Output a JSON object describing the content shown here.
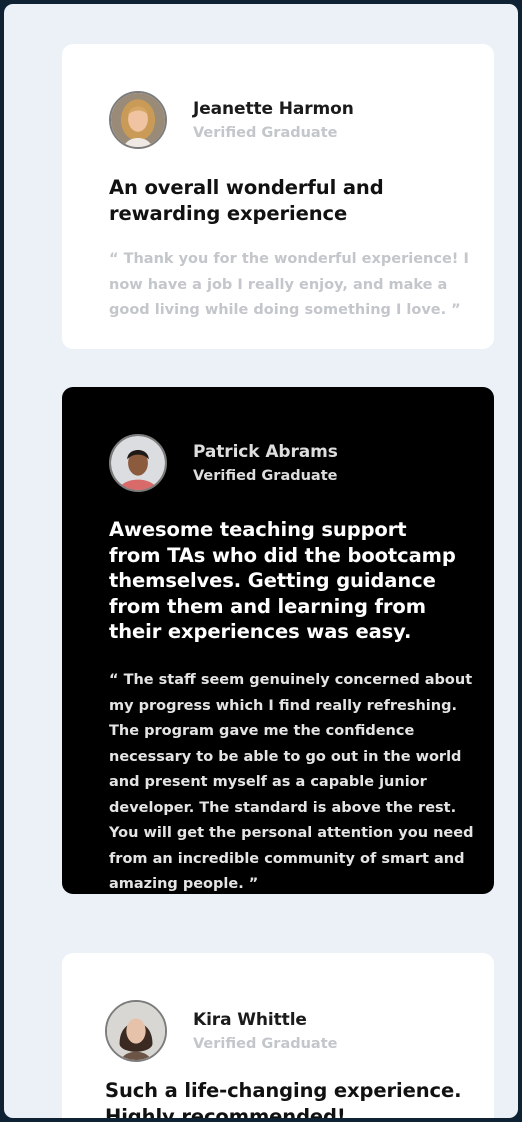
{
  "testimonials": [
    {
      "name": "Jeanette Harmon",
      "status": "Verified Graduate",
      "headline": "An overall wonderful and rewarding experience",
      "quote": "“ Thank you for the wonderful experience! I now have a job I really enjoy, and make a good living while doing something I love. ”"
    },
    {
      "name": "Patrick Abrams",
      "status": "Verified Graduate",
      "headline": "Awesome teaching support from TAs who did the bootcamp themselves. Getting guidance from them and learning from their experiences was easy.",
      "quote": "“ The staff seem genuinely concerned about my progress which I find really refreshing. The program gave me the confidence necessary to be able to go out in the world and present myself as a capable junior developer. The standard is above the rest. You will get the personal attention you need from an incredible community of smart and amazing people. ”"
    },
    {
      "name": "Kira Whittle",
      "status": "Verified Graduate",
      "headline": "Such a life-changing experience. Highly recommended!"
    }
  ],
  "colors": {
    "page_background": "#ebf1f7",
    "light_card": "#ffffff",
    "dark_card": "#000000",
    "muted_text": "#c3c6ca"
  }
}
